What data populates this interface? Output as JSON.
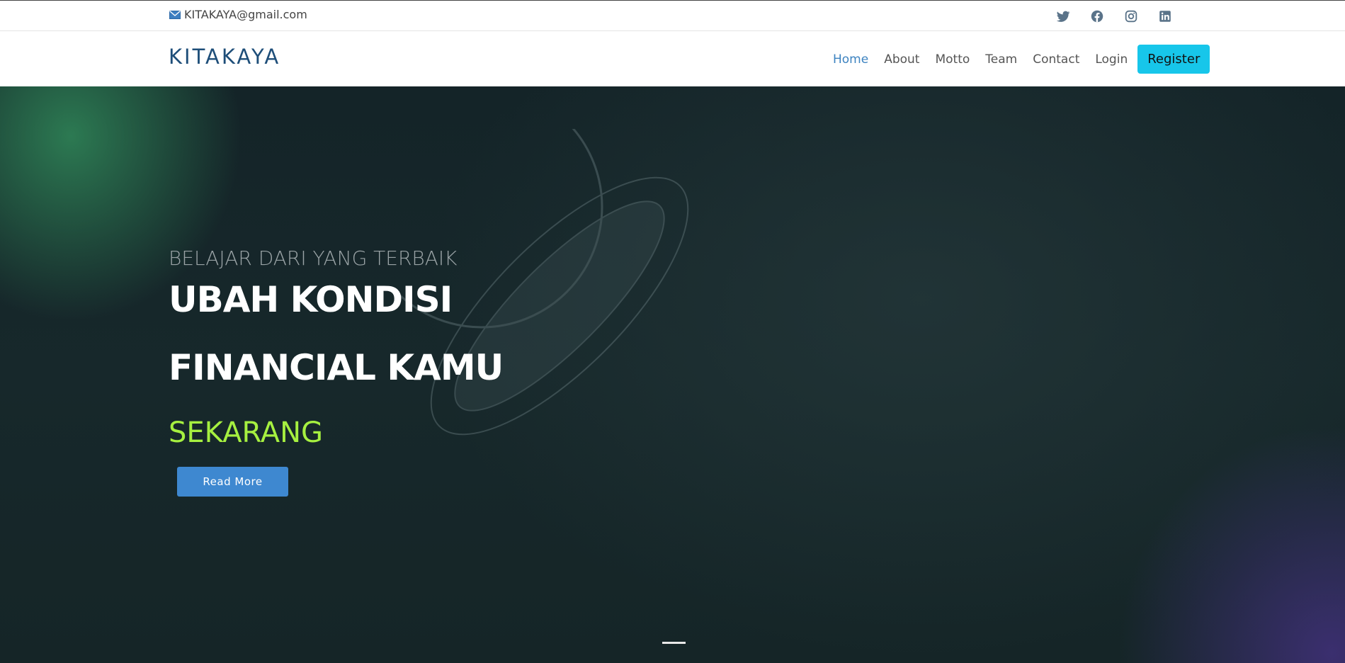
{
  "topbar": {
    "email": "KITAKAYA@gmail.com",
    "email_icon": "envelope-icon",
    "social_icons": [
      "twitter-icon",
      "facebook-icon",
      "instagram-icon",
      "linkedin-icon"
    ]
  },
  "navbar": {
    "logo": "KITAKAYA",
    "menu": [
      {
        "label": "Home",
        "active": true
      },
      {
        "label": "About"
      },
      {
        "label": "Motto"
      },
      {
        "label": "Team"
      },
      {
        "label": "Contact"
      },
      {
        "label": "Login"
      }
    ],
    "register_label": "Register"
  },
  "hero": {
    "eyebrow": "BELAJAR DARI YANG TERBAIK",
    "headline_line1": "UBAH KONDISI",
    "headline_line2": "FINANCIAL KAMU",
    "highlight": "SEKARANG",
    "cta_label": "Read More"
  },
  "colors": {
    "logo": "#1e4e79",
    "nav_active": "#3d83c0",
    "register_bg": "#17c6ea",
    "cta_bg": "#3e88d0",
    "highlight": "#a6f040",
    "hero_bg": "#17282b"
  }
}
